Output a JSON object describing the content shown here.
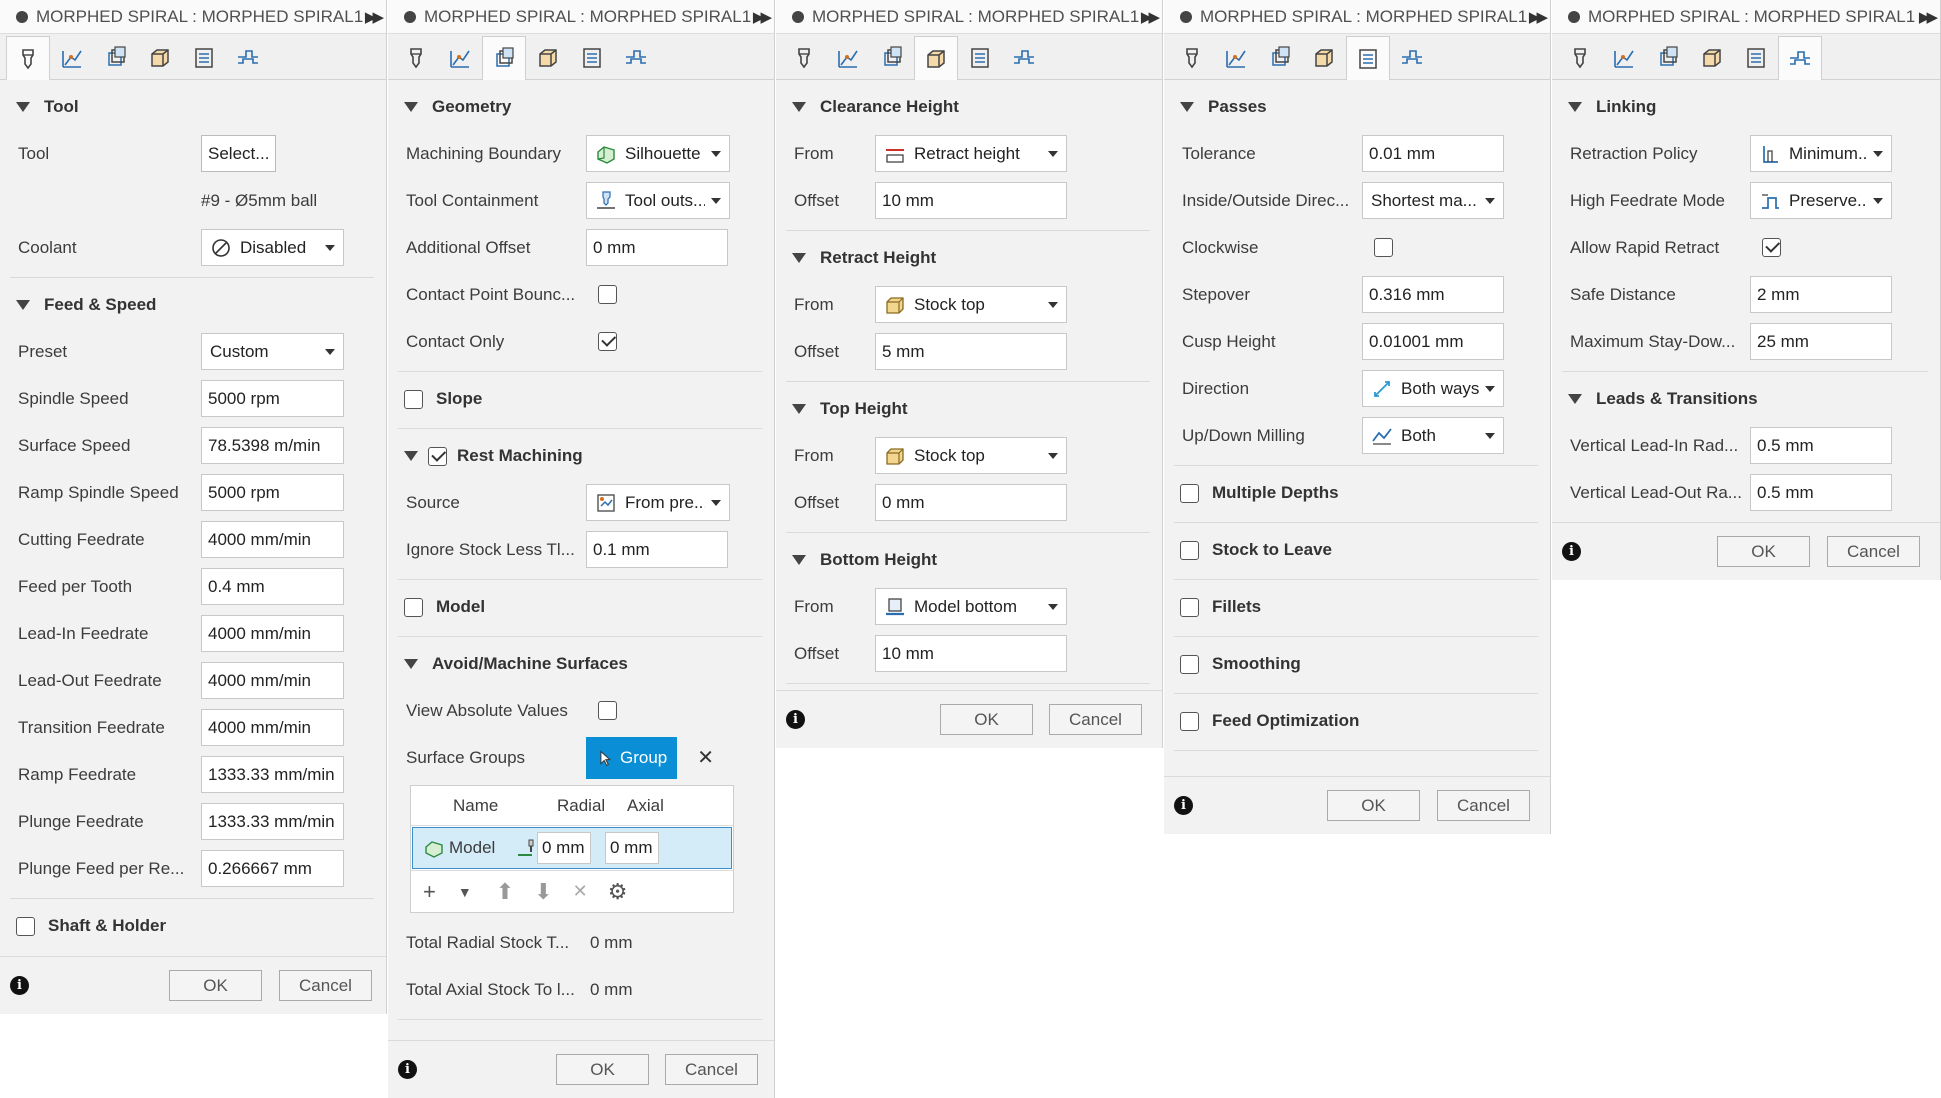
{
  "title": "MORPHED SPIRAL : MORPHED SPIRAL1",
  "buttons": {
    "ok": "OK",
    "cancel": "Cancel"
  },
  "tabs": [
    "tool-tab",
    "geometry-tab",
    "heights-tab",
    "passes-tab",
    "linking-tab",
    "simulation-tab"
  ],
  "p1": {
    "tool_section": "Tool",
    "tool_label": "Tool",
    "tool_select": "Select...",
    "tool_desc": "#9 - Ø5mm ball",
    "coolant_label": "Coolant",
    "coolant_value": "Disabled",
    "feed_section": "Feed & Speed",
    "preset_label": "Preset",
    "preset_value": "Custom",
    "fields": [
      {
        "label": "Spindle Speed",
        "value": "5000 rpm"
      },
      {
        "label": "Surface Speed",
        "value": "78.5398 m/min"
      },
      {
        "label": "Ramp Spindle Speed",
        "value": "5000 rpm"
      },
      {
        "label": "Cutting Feedrate",
        "value": "4000 mm/min"
      },
      {
        "label": "Feed per Tooth",
        "value": "0.4 mm"
      },
      {
        "label": "Lead-In Feedrate",
        "value": "4000 mm/min"
      },
      {
        "label": "Lead-Out Feedrate",
        "value": "4000 mm/min"
      },
      {
        "label": "Transition Feedrate",
        "value": "4000 mm/min"
      },
      {
        "label": "Ramp Feedrate",
        "value": "1333.33 mm/min"
      },
      {
        "label": "Plunge Feedrate",
        "value": "1333.33 mm/min"
      },
      {
        "label": "Plunge Feed per Re...",
        "value": "0.266667 mm"
      }
    ],
    "shaft_section": "Shaft & Holder"
  },
  "p2": {
    "geom_section": "Geometry",
    "mb_label": "Machining Boundary",
    "mb_value": "Silhouette",
    "tc_label": "Tool Containment",
    "tc_value": "Tool outs...",
    "ao_label": "Additional Offset",
    "ao_value": "0 mm",
    "cpb_label": "Contact Point Bounc...",
    "co_label": "Contact Only",
    "slope_section": "Slope",
    "rest_section": "Rest Machining",
    "src_label": "Source",
    "src_value": "From pre...",
    "ign_label": "Ignore Stock Less Tl...",
    "ign_value": "0.1 mm",
    "model_section": "Model",
    "avoid_section": "Avoid/Machine Surfaces",
    "vav_label": "View Absolute Values",
    "sg_label": "Surface Groups",
    "sg_button": "Group",
    "table": {
      "headers": [
        "Name",
        "Radial",
        "Axial"
      ],
      "row": {
        "name": "Model",
        "radial": "0 mm",
        "axial": "0 mm"
      }
    },
    "trs_label": "Total Radial Stock T...",
    "trs_value": "0 mm",
    "tas_label": "Total Axial Stock To l...",
    "tas_value": "0 mm"
  },
  "p3": {
    "sections": [
      {
        "title": "Clearance Height",
        "from_label": "From",
        "from_value": "Retract height",
        "offset_label": "Offset",
        "offset_value": "10 mm"
      },
      {
        "title": "Retract Height",
        "from_label": "From",
        "from_value": "Stock top",
        "offset_label": "Offset",
        "offset_value": "5 mm"
      },
      {
        "title": "Top Height",
        "from_label": "From",
        "from_value": "Stock top",
        "offset_label": "Offset",
        "offset_value": "0 mm"
      },
      {
        "title": "Bottom Height",
        "from_label": "From",
        "from_value": "Model bottom",
        "offset_label": "Offset",
        "offset_value": "10 mm"
      }
    ]
  },
  "p4": {
    "passes_section": "Passes",
    "tol_label": "Tolerance",
    "tol_value": "0.01 mm",
    "io_label": "Inside/Outside Direc...",
    "io_value": "Shortest ma...",
    "cw_label": "Clockwise",
    "step_label": "Stepover",
    "step_value": "0.316 mm",
    "cusp_label": "Cusp Height",
    "cusp_value": "0.01001 mm",
    "dir_label": "Direction",
    "dir_value": "Both ways",
    "ud_label": "Up/Down Milling",
    "ud_value": "Both",
    "collapsed": [
      "Multiple Depths",
      "Stock to Leave",
      "Fillets",
      "Smoothing",
      "Feed Optimization"
    ]
  },
  "p5": {
    "link_section": "Linking",
    "rp_label": "Retraction Policy",
    "rp_value": "Minimum...",
    "hf_label": "High Feedrate Mode",
    "hf_value": "Preserve...",
    "arr_label": "Allow Rapid Retract",
    "sd_label": "Safe Distance",
    "sd_value": "2 mm",
    "ms_label": "Maximum Stay-Dow...",
    "ms_value": "25 mm",
    "lt_section": "Leads & Transitions",
    "vli_label": "Vertical Lead-In Rad...",
    "vli_value": "0.5 mm",
    "vlo_label": "Vertical Lead-Out Ra...",
    "vlo_value": "0.5 mm"
  }
}
